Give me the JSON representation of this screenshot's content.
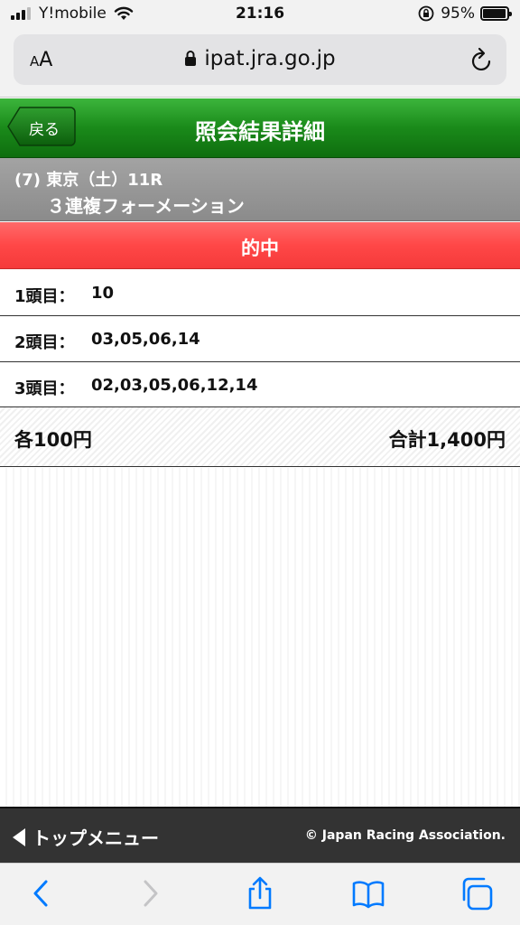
{
  "status_bar": {
    "carrier": "Y!mobile",
    "time": "21:16",
    "battery": "95%",
    "battery_level": 0.95
  },
  "browser": {
    "text_size_label_small": "A",
    "text_size_label_large": "A",
    "url": "ipat.jra.go.jp"
  },
  "header": {
    "back_label": "戻る",
    "title": "照会結果詳細"
  },
  "race": {
    "line1": "(7) 東京（土）11R",
    "line2": "３連複フォーメーション"
  },
  "result": {
    "status": "的中"
  },
  "selections": [
    {
      "label": "1頭目：",
      "value": "10"
    },
    {
      "label": "2頭目：",
      "value": "03,05,06,14"
    },
    {
      "label": "3頭目：",
      "value": "02,03,05,06,12,14"
    }
  ],
  "totals": {
    "each": "各100円",
    "total": "合計1,400円"
  },
  "footer": {
    "menu_label": "トップメニュー",
    "copyright": "© Japan Racing Association."
  },
  "toolbar": {
    "icons": [
      "back-icon",
      "forward-icon",
      "share-icon",
      "bookmarks-icon",
      "tabs-icon"
    ]
  },
  "colors": {
    "header_green": "#1a8a1a",
    "hit_red": "#ff4747",
    "race_gray": "#9a9a9a",
    "ios_blue": "#007aff"
  }
}
